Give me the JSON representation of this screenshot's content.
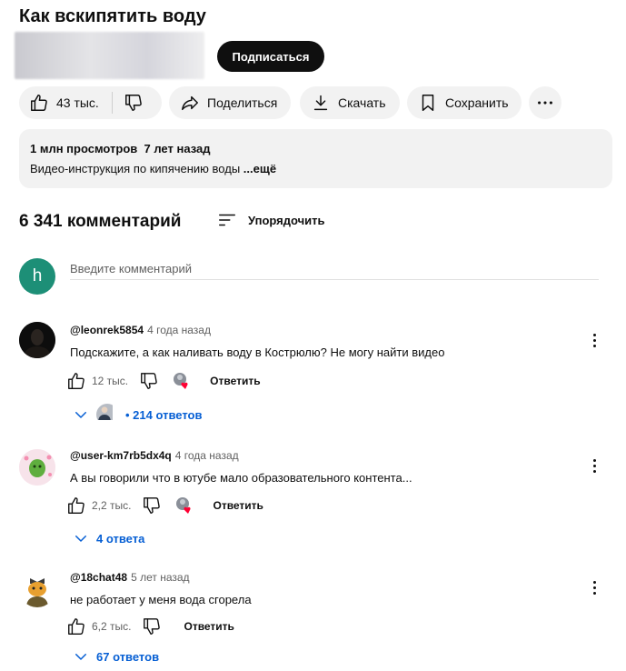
{
  "video": {
    "title": "Как вскипятить воду",
    "subscribe_label": "Подписаться",
    "likes": "43 тыс.",
    "share_label": "Поделиться",
    "download_label": "Скачать",
    "save_label": "Сохранить"
  },
  "description": {
    "meta": "1 млн просмотров  7 лет назад",
    "text": "Видео-инструкция по кипячению воды ",
    "more_label": "...ещё"
  },
  "comments_section": {
    "count_label": "6 341 комментарий",
    "sort_label": "Упорядочить",
    "my_avatar_letter": "h",
    "input_placeholder": "Введите комментарий"
  },
  "comments": [
    {
      "author": "@leonrek5854",
      "time": "4 года назад",
      "text": "Подскажите, а как наливать воду в Кострюлю?  Не могу найти видео",
      "likes": "12 тыс.",
      "reply_label": "Ответить",
      "replies_label": "• 214 ответов"
    },
    {
      "author": "@user-km7rb5dx4q",
      "time": "4 года назад",
      "text": "А вы говорили что в ютубе мало образовательного контента...",
      "likes": "2,2 тыс.",
      "reply_label": "Ответить",
      "replies_label": "4 ответа"
    },
    {
      "author": "@18chat48",
      "time": "5 лет назад",
      "text": "не работает у меня вода сгорела",
      "likes": "6,2 тыс.",
      "reply_label": "Ответить",
      "replies_label": "67 ответов"
    }
  ],
  "colors": {
    "accent_link": "#065fd4",
    "heart": "#ff0033",
    "my_avatar_bg": "#1d8f77"
  }
}
